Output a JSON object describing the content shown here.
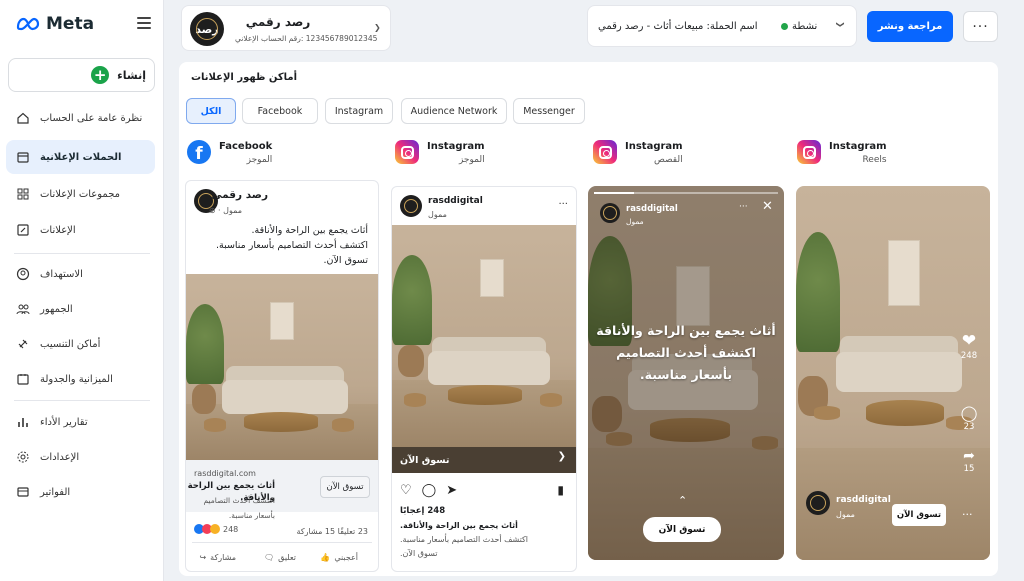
{
  "brand": {
    "logo_text": "Meta"
  },
  "sidebar": {
    "create_label": "إنشاء",
    "items": [
      {
        "label": "نظرة عامة على الحساب",
        "icon": "home-icon"
      },
      {
        "label": "الحملات الإعلانية",
        "icon": "campaigns-icon",
        "active": true
      },
      {
        "label": "مجموعات الإعلانات",
        "icon": "grid-icon"
      },
      {
        "label": "الإعلانات",
        "icon": "ad-edit-icon"
      },
      {
        "label": "الاستهداف",
        "icon": "target-user-icon"
      },
      {
        "label": "الجمهور",
        "icon": "audience-icon"
      },
      {
        "label": "أماكن التنسيب",
        "icon": "placements-icon"
      },
      {
        "label": "الميزانية والجدولة",
        "icon": "calendar-icon"
      },
      {
        "label": "تقارير الأداء",
        "icon": "bar-chart-icon"
      },
      {
        "label": "الإعدادات",
        "icon": "gear-icon"
      },
      {
        "label": "الفواتير",
        "icon": "billing-icon"
      }
    ]
  },
  "header": {
    "account_name": "رصد رقمي",
    "account_id_line": "123456789012345 :رقم الحساب الإعلاني",
    "status": "نشطة",
    "campaign_name": "اسم الحملة: مبيعات أثاث - رصد رقمي",
    "publish_label": "مراجعة ونشر",
    "more_label": "···",
    "avatar_text": "رصد"
  },
  "placements": {
    "title": "أماكن ظهور الإعلانات",
    "tabs": [
      "الكل",
      "Facebook",
      "Instagram",
      "Audience Network",
      "Messenger"
    ],
    "columns": [
      {
        "platform": "Facebook",
        "sub": "الموجز"
      },
      {
        "platform": "Instagram",
        "sub": "الموجز"
      },
      {
        "platform": "Instagram",
        "sub": "القصص"
      },
      {
        "platform": "Instagram",
        "sub": "Reels"
      }
    ]
  },
  "fb_post": {
    "page_name": "رصد رقمي",
    "sponsored": "ممول · ⊕",
    "text_lines": [
      "أثاث يجمع بين الراحة والأناقة.",
      "اكتشف أحدث التصاميم بأسعار مناسبة.",
      "تسوق الآن."
    ],
    "domain": "rasddigital.com",
    "headline": "أثاث يجمع بين الراحة والأناقة.",
    "description": "اكتشف أحدث التصاميم بأسعار مناسبة.",
    "cta": "تسوق الآن",
    "reactions_count": "248",
    "stats": "23 تعليقًا  15 مشاركة",
    "actions": [
      "أعجبني",
      "تعليق",
      "مشاركة"
    ]
  },
  "ig_feed": {
    "handle": "rasddigital",
    "sponsored": "ممول",
    "cta": "تسوق الآن",
    "likes": "248 إعجابًا",
    "caption_lines": [
      "أثاث يجمع بين الراحة والأناقة.",
      "اكتشف أحدث التصاميم بأسعار مناسبة.",
      "تسوق الآن."
    ]
  },
  "ig_story": {
    "handle": "rasddigital",
    "sponsored": "ممول",
    "text_lines": [
      "أثاث يجمع بين الراحة والأناقة",
      "اكتشف أحدث التصاميم",
      "بأسعار مناسبة."
    ],
    "cta": "تسوق الآن"
  },
  "ig_reels": {
    "handle": "rasddigital",
    "sponsored": "ممول",
    "likes": "248",
    "comments": "23",
    "shares": "15",
    "cta": "تسوق الآن"
  },
  "colors": {
    "accent": "#0866ff",
    "active_bg": "#e7f0fd",
    "status": "#22a54a"
  }
}
